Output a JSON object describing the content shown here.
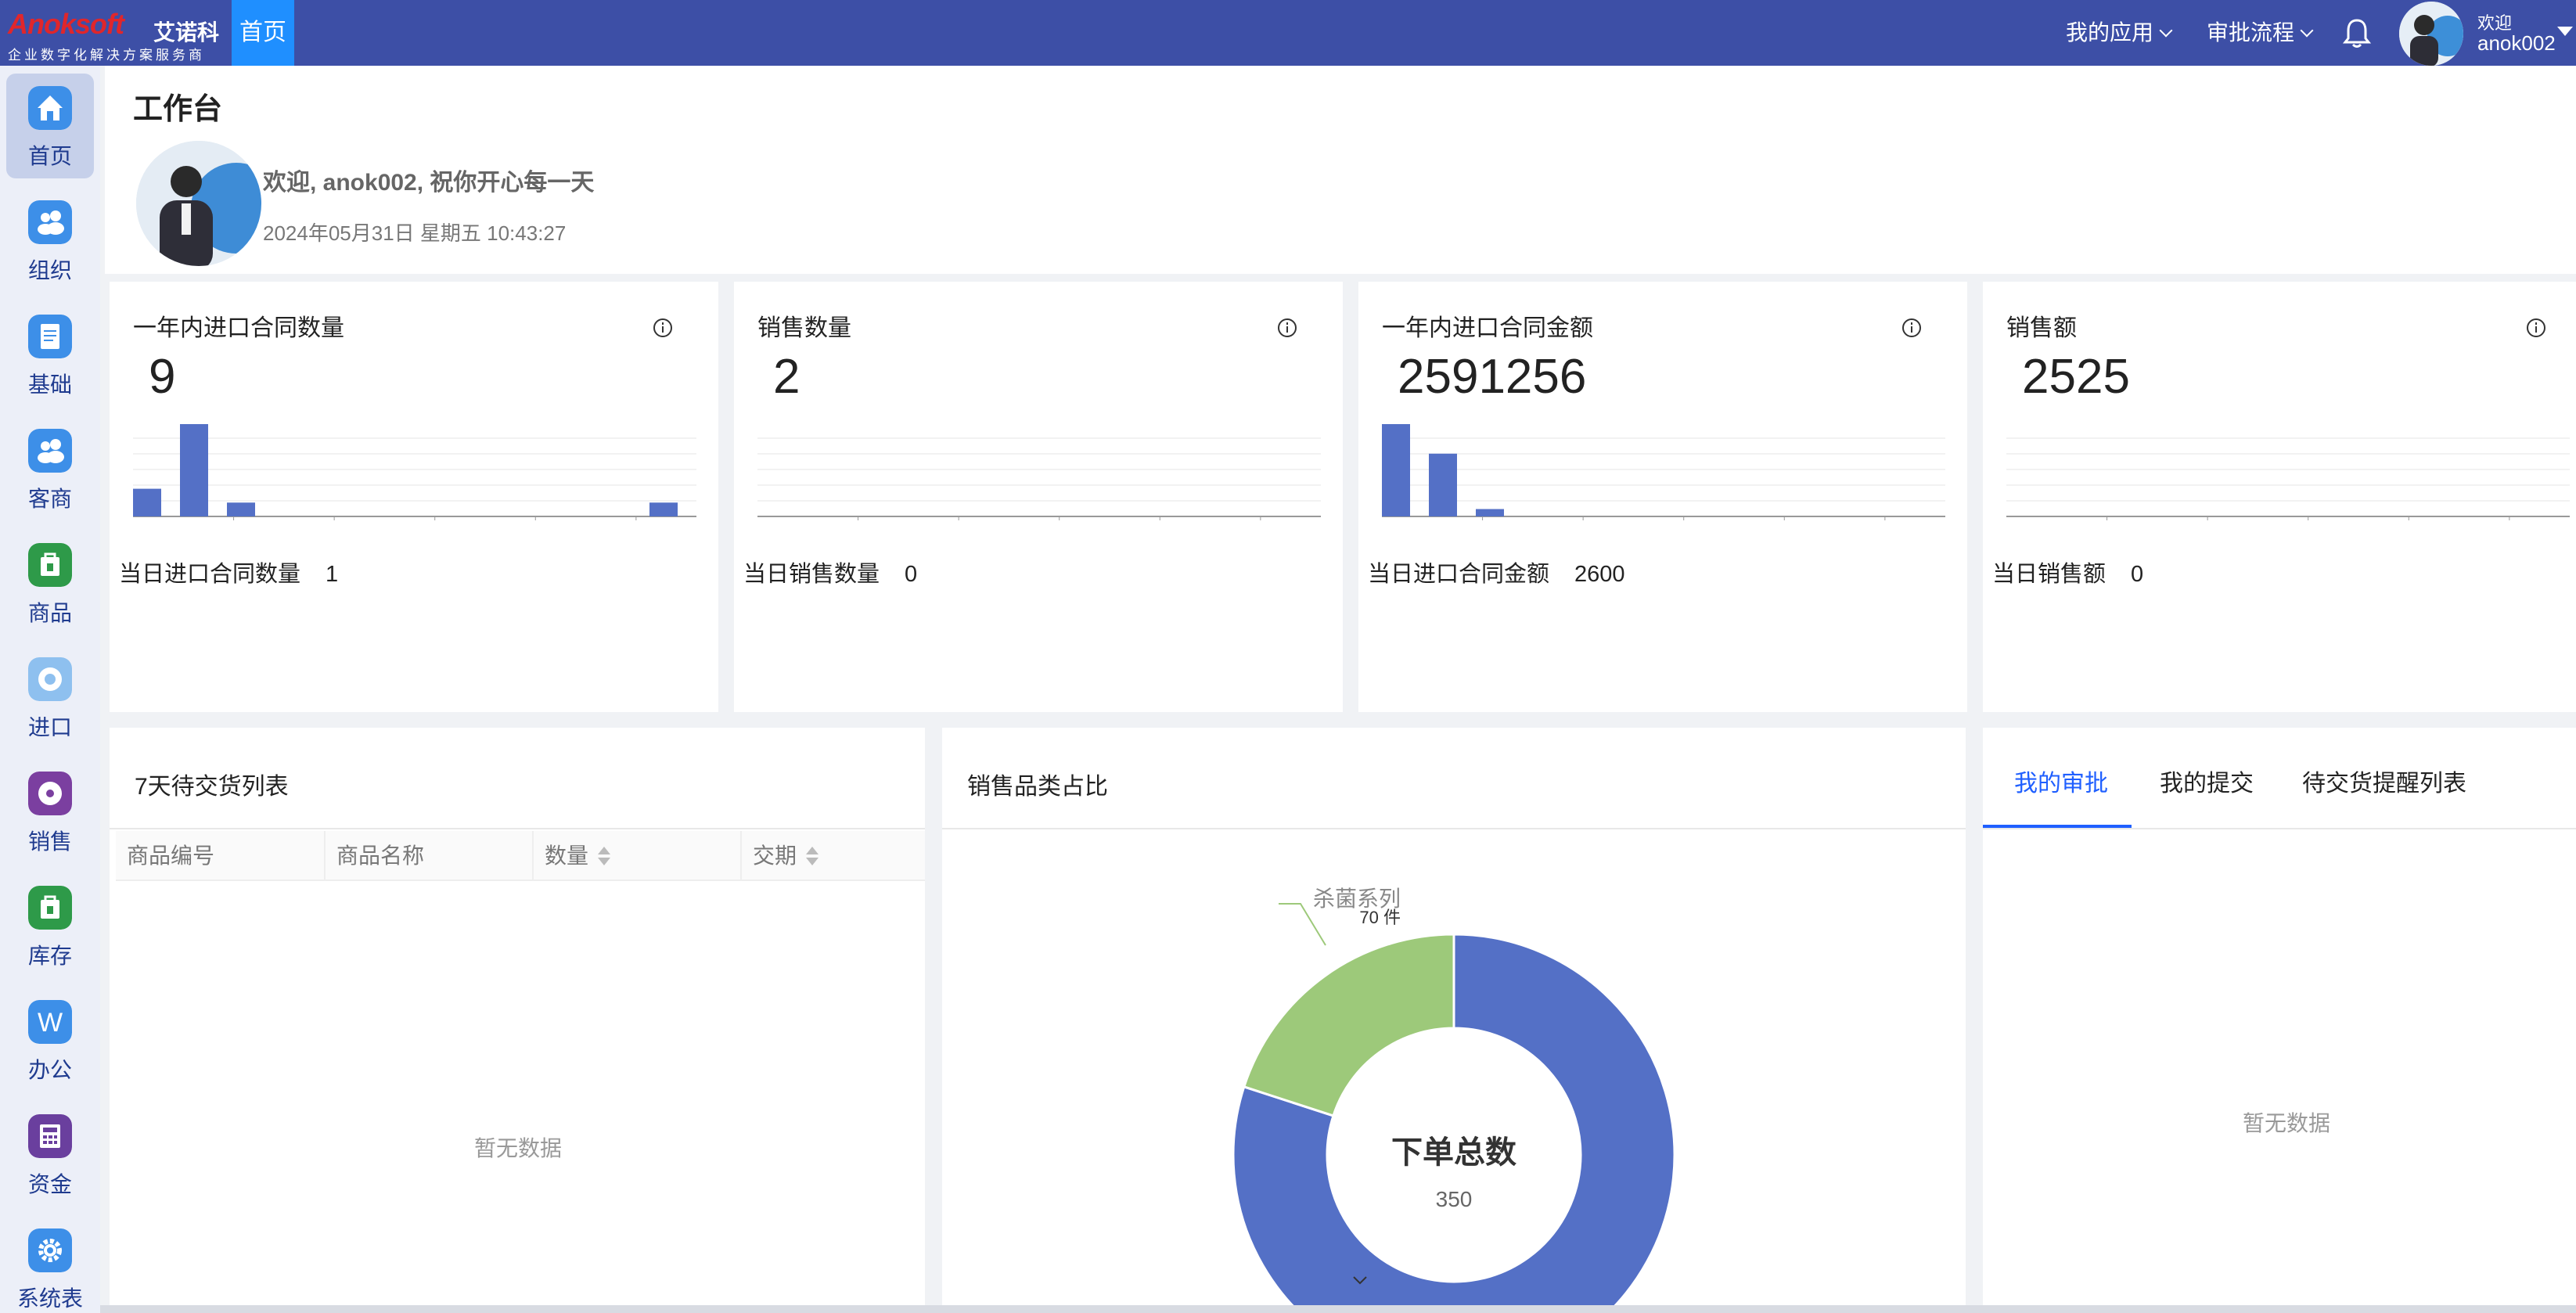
{
  "brand": {
    "logo_text": "Anoksoft",
    "name_cn": "艾诺科",
    "slogan": "企业数字化解决方案服务商"
  },
  "topbar": {
    "home_tab": "首页",
    "menus": [
      "我的应用",
      "审批流程"
    ],
    "welcome": "欢迎",
    "username": "anok002"
  },
  "sidebar": {
    "items": [
      {
        "label": "首页",
        "icon": "home-icon",
        "color": "#3d8fe8"
      },
      {
        "label": "组织",
        "icon": "people-icon",
        "color": "#3d8fe8"
      },
      {
        "label": "基础",
        "icon": "document-icon",
        "color": "#3d8fe8"
      },
      {
        "label": "客商",
        "icon": "people-icon",
        "color": "#3d8fe8"
      },
      {
        "label": "商品",
        "icon": "bag-icon",
        "color": "#2e9a49"
      },
      {
        "label": "进口",
        "icon": "globe-icon",
        "color": "#3d8fe8"
      },
      {
        "label": "销售",
        "icon": "disc-icon",
        "color": "#7b3fa0"
      },
      {
        "label": "库存",
        "icon": "bag-icon",
        "color": "#2e9a49"
      },
      {
        "label": "办公",
        "icon": "w-icon",
        "color": "#3d8fe8"
      },
      {
        "label": "资金",
        "icon": "calculator-icon",
        "color": "#6a3f9e"
      },
      {
        "label": "系统表",
        "icon": "gear-icon",
        "color": "#3d8fe8"
      }
    ]
  },
  "header": {
    "title": "工作台",
    "greeting": "欢迎, anok002, 祝你开心每一天",
    "datetime": "2024年05月31日 星期五 10:43:27"
  },
  "stats": [
    {
      "title": "一年内进口合同数量",
      "value": "9",
      "footer_label": "当日进口合同数量",
      "footer_value": "1",
      "bars": [
        3,
        10,
        1.5,
        0,
        0,
        0,
        0,
        0,
        0,
        0,
        0,
        1.5
      ],
      "max": 10
    },
    {
      "title": "销售数量",
      "value": "2",
      "footer_label": "当日销售数量",
      "footer_value": "0",
      "bars": [],
      "max": 10
    },
    {
      "title": "一年内进口合同金额",
      "value": "2591256",
      "footer_label": "当日进口合同金额",
      "footer_value": "2600",
      "bars": [
        10,
        6.8,
        0.8,
        0,
        0,
        0,
        0,
        0,
        0,
        0,
        0,
        0
      ],
      "max": 10
    },
    {
      "title": "销售额",
      "value": "2525",
      "footer_label": "当日销售额",
      "footer_value": "0",
      "bars": [],
      "max": 10
    }
  ],
  "delivery": {
    "title": "7天待交货列表",
    "columns": [
      "商品编号",
      "商品名称",
      "数量",
      "交期"
    ],
    "empty": "暂无数据"
  },
  "category": {
    "title": "销售品类占比",
    "center_label": "下单总数",
    "center_value": "350",
    "slice_label": "杀菌系列",
    "slice_value": "70 件"
  },
  "approvals": {
    "tabs": [
      "我的审批",
      "我的提交",
      "待交货提醒列表"
    ],
    "empty": "暂无数据"
  },
  "chart_data": {
    "type": "pie",
    "title": "销售品类占比",
    "total": 350,
    "slices": [
      {
        "label": "杀菌系列",
        "value": 70,
        "color": "#9dc97a"
      },
      {
        "label": "",
        "value": 280,
        "color": "#5470c6"
      }
    ]
  }
}
